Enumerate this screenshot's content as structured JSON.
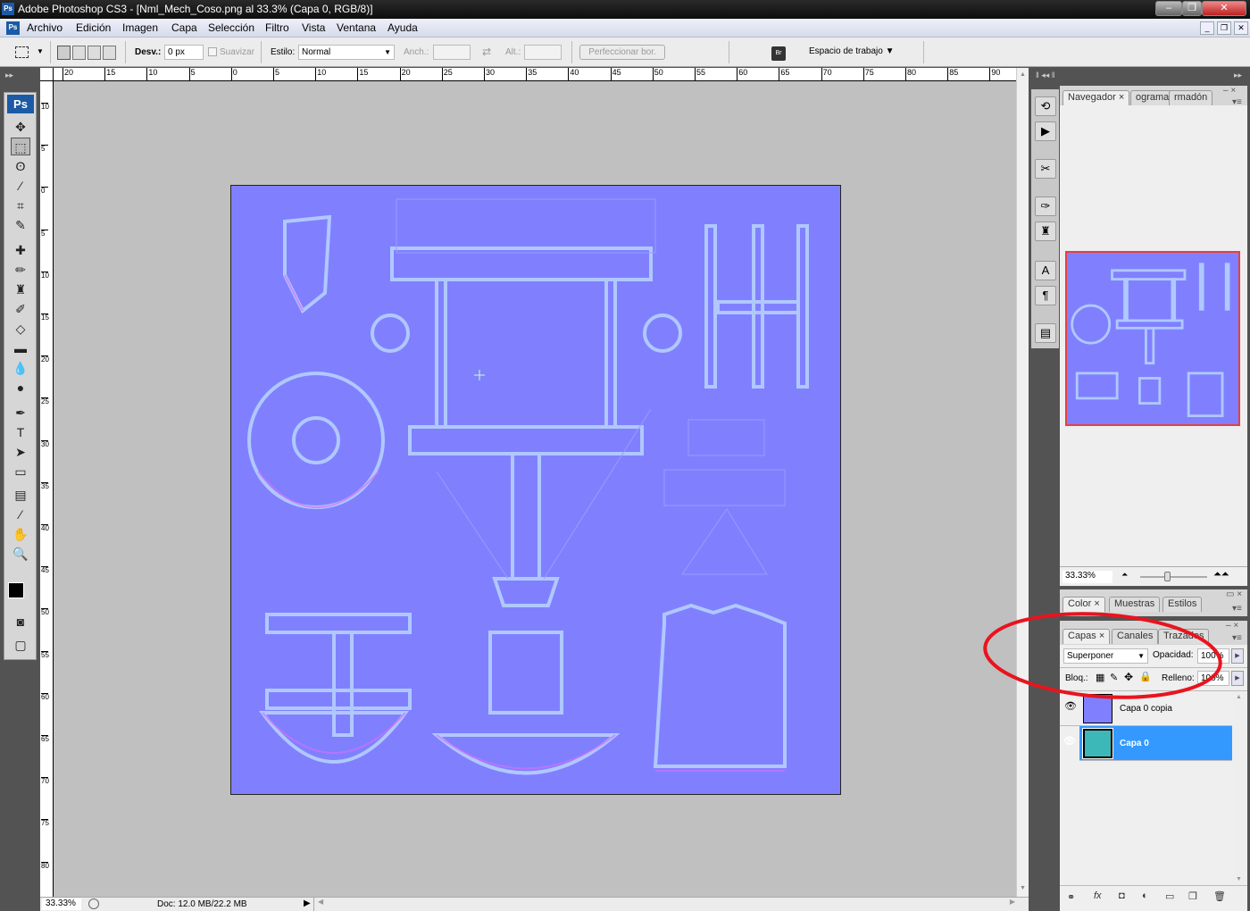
{
  "window": {
    "title": "Adobe Photoshop CS3 - [Nml_Mech_Coso.png al 33.3% (Capa 0, RGB/8)]",
    "logo": "Ps"
  },
  "menu": [
    "Archivo",
    "Edición",
    "Imagen",
    "Capa",
    "Selección",
    "Filtro",
    "Vista",
    "Ventana",
    "Ayuda"
  ],
  "options": {
    "feather_label": "Desv.:",
    "feather_value": "0 px",
    "antialias_label": "Suavizar",
    "style_label": "Estilo:",
    "style_value": "Normal",
    "width_label": "Anch.:",
    "height_label": "Alt.:",
    "refine_label": "Perfeccionar bor.",
    "workspace_label": "Espacio de trabajo",
    "bridge": "Br"
  },
  "rulers": {
    "top": [
      "20",
      "15",
      "10",
      "5",
      "0",
      "5",
      "10",
      "15",
      "20",
      "25",
      "30",
      "35",
      "40",
      "45",
      "50",
      "55",
      "60",
      "65",
      "70",
      "75",
      "80",
      "85",
      "90"
    ],
    "left": [
      "10",
      "5",
      "0",
      "5",
      "10",
      "15",
      "20",
      "25",
      "30",
      "35",
      "40",
      "45",
      "50",
      "55",
      "60",
      "65",
      "70",
      "75",
      "80"
    ]
  },
  "status": {
    "zoom": "33.33%",
    "doc": "Doc: 12.0 MB/22.2 MB"
  },
  "navigator": {
    "tabs": [
      "Navegador",
      "ograma",
      "rmadón"
    ],
    "zoom": "33.33%"
  },
  "color_panel": {
    "tabs": [
      "Color",
      "Muestras",
      "Estilos"
    ]
  },
  "layers_panel": {
    "tabs": [
      "Capas",
      "Canales",
      "Trazados"
    ],
    "blend_mode": "Superponer",
    "opacity_label": "Opacidad:",
    "opacity_value": "100%",
    "lock_label": "Bloq.:",
    "fill_label": "Relleno:",
    "fill_value": "100%",
    "layers": [
      {
        "name": "Capa 0 copia",
        "selected": false
      },
      {
        "name": "Capa 0",
        "selected": true
      }
    ]
  },
  "colors": {
    "normal_map": "#8080ff",
    "selection": "#3399ff",
    "annotation": "#e8141e"
  }
}
